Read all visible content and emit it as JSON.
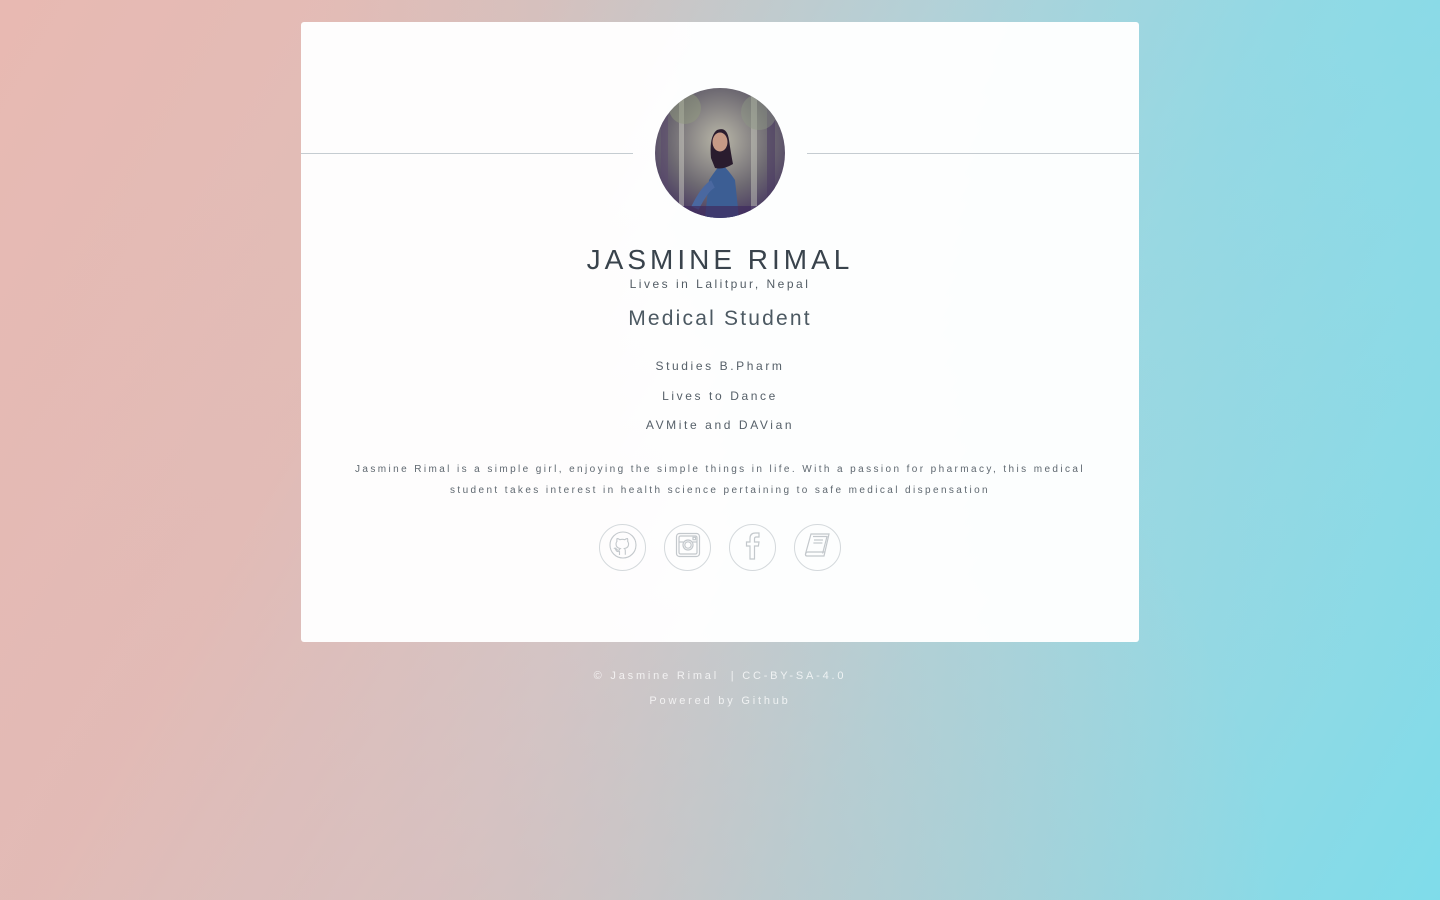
{
  "profile": {
    "name": "JASMINE RIMAL",
    "location": "Lives in Lalitpur, Nepal",
    "role": "Medical Student",
    "facts": [
      "Studies B.Pharm",
      "Lives to Dance",
      "AVMite and DAVian"
    ],
    "bio": "Jasmine Rimal is a simple girl, enjoying the simple things in life. With a passion for pharmacy, this medical student takes interest in health science pertaining to safe medical dispensation"
  },
  "socials": [
    {
      "icon": "github-icon"
    },
    {
      "icon": "instagram-icon"
    },
    {
      "icon": "facebook-icon"
    },
    {
      "icon": "book-icon"
    }
  ],
  "footer": {
    "copyright": "© Jasmine Rimal",
    "separator": "|",
    "license": "CC-BY-SA-4.0",
    "powered_prefix": "Powered by",
    "powered_link": "Github"
  },
  "colors": {
    "text_primary": "#39434c",
    "icon_stroke": "#c3c8cc",
    "bg_left": "#e8b9b2",
    "bg_right": "#7fdcea"
  }
}
